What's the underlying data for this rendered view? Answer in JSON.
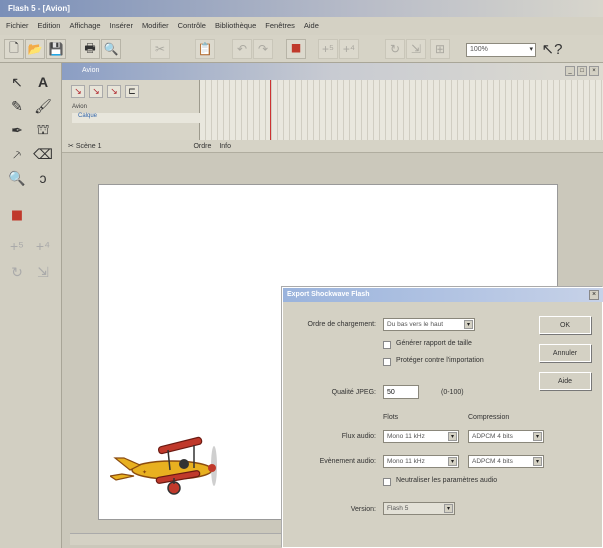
{
  "app": {
    "title": "Flash 5 - [Avion]"
  },
  "menu": {
    "items": [
      "Fichier",
      "Edition",
      "Affichage",
      "Insérer",
      "Modifier",
      "Contrôle",
      "Bibliothèque",
      "Fenêtres",
      "Aide"
    ]
  },
  "toolbar": {
    "zoom_value": "100%"
  },
  "document": {
    "title": "Avion"
  },
  "timeline": {
    "layers": [
      "Avion",
      "Calque"
    ]
  },
  "scene": {
    "label": "Scène 1",
    "tab1": "Ordre",
    "tab2": "Info"
  },
  "dialog": {
    "title": "Export Shockwave Flash",
    "load_order_label": "Ordre de chargement:",
    "load_order_value": "Du bas vers le haut",
    "checkbox_size_report": "Générer rapport de taille",
    "checkbox_protect_import": "Protéger contre l'importation",
    "jpeg_quality_label": "Qualité JPEG:",
    "jpeg_quality_value": "50",
    "jpeg_range": "(0-100)",
    "rate_header": "Flots",
    "compression_header": "Compression",
    "stream_audio_label": "Flux audio:",
    "stream_audio_rate": "Mono 11 kHz",
    "stream_audio_comp": "ADPCM 4 bits",
    "event_audio_label": "Evènement audio:",
    "event_audio_rate": "Mono 11 kHz",
    "event_audio_comp": "ADPCM 4 bits",
    "checkbox_override": "Neutraliser les paramètres audio",
    "version_label": "Version:",
    "version_value": "Flash 5",
    "ok_label": "OK",
    "cancel_label": "Annuler",
    "help_label": "Aide"
  },
  "colors": {
    "accent": "#9ab3dc",
    "plane": "#e8b020"
  }
}
